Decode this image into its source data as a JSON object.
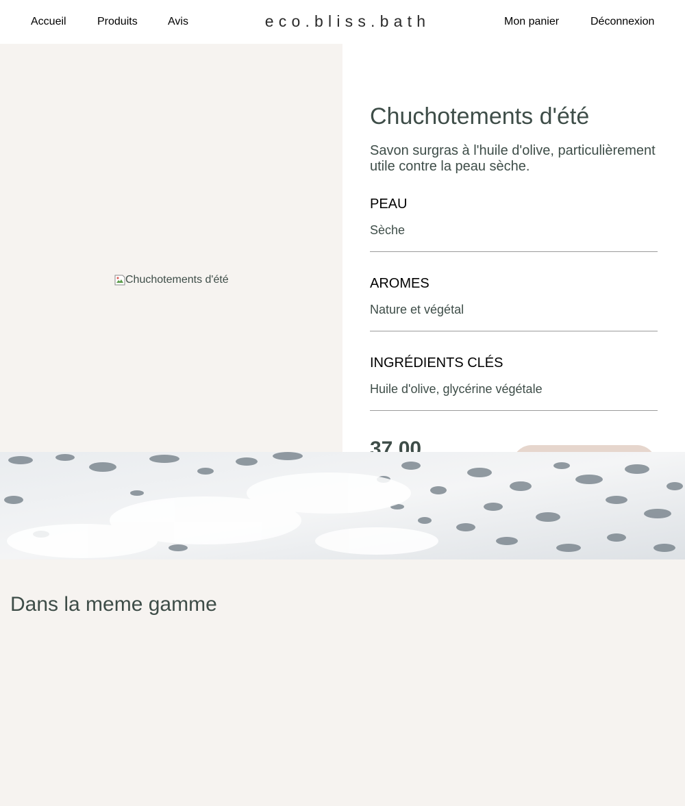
{
  "header": {
    "nav_left": [
      "Accueil",
      "Produits",
      "Avis"
    ],
    "logo": "eco.bliss.bath",
    "nav_right": [
      "Mon panier",
      "Déconnexion"
    ]
  },
  "product": {
    "image_alt": "Chuchotements d'été",
    "title": "Chuchotements d'été",
    "description": "Savon surgras à l'huile d'olive, particulièrement utile contre la peau sèche.",
    "attributes": [
      {
        "label": "PEAU",
        "value": "Sèche"
      },
      {
        "label": "AROMES",
        "value": "Nature et végétal"
      },
      {
        "label": "INGRÉDIENTS CLÉS",
        "value": "Huile d'olive, glycérine végétale"
      }
    ],
    "price": "37,00",
    "add_to_cart_label": ""
  },
  "related": {
    "title": "Dans la meme gamme"
  },
  "colors": {
    "page_bg": "#f6f3f0",
    "text_main": "#3e4d48",
    "button_bg": "#e6d6cd"
  }
}
